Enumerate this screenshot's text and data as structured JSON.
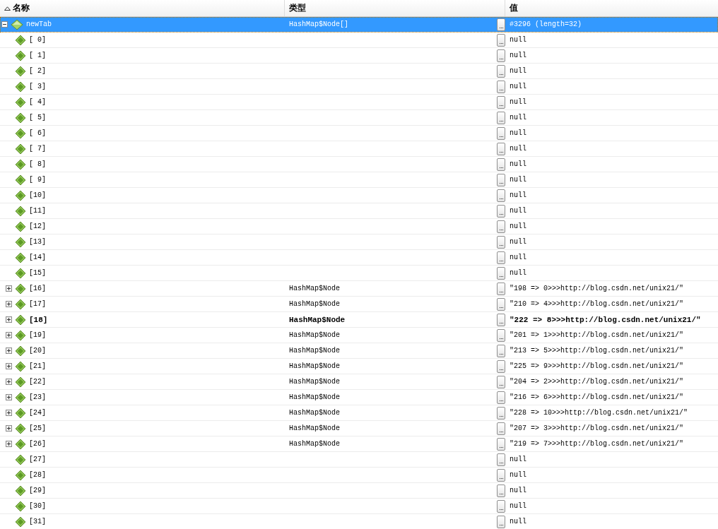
{
  "columns": [
    "名称",
    "类型",
    "值"
  ],
  "root": {
    "name": "newTab",
    "type": "HashMap$Node[]",
    "value": "#3296 (length=32)",
    "selected": true,
    "expanded": true,
    "children": [
      {
        "name": "[ 0]",
        "value": "null",
        "changed": false
      },
      {
        "name": "[ 1]",
        "value": "null",
        "changed": false
      },
      {
        "name": "[ 2]",
        "value": "null",
        "changed": false
      },
      {
        "name": "[ 3]",
        "value": "null",
        "changed": false
      },
      {
        "name": "[ 4]",
        "value": "null",
        "changed": false
      },
      {
        "name": "[ 5]",
        "value": "null",
        "changed": false
      },
      {
        "name": "[ 6]",
        "value": "null",
        "changed": false
      },
      {
        "name": "[ 7]",
        "value": "null",
        "changed": false
      },
      {
        "name": "[ 8]",
        "value": "null",
        "changed": false
      },
      {
        "name": "[ 9]",
        "value": "null",
        "changed": false
      },
      {
        "name": "[10]",
        "value": "null",
        "changed": false
      },
      {
        "name": "[11]",
        "value": "null",
        "changed": false
      },
      {
        "name": "[12]",
        "value": "null",
        "changed": false
      },
      {
        "name": "[13]",
        "value": "null",
        "changed": false
      },
      {
        "name": "[14]",
        "value": "null",
        "changed": false
      },
      {
        "name": "[15]",
        "value": "null",
        "changed": false
      },
      {
        "name": "[16]",
        "type": "HashMap$Node",
        "value": "\"198 => 0>>>http://blog.csdn.net/unix21/\"",
        "expanded": false,
        "changed": false
      },
      {
        "name": "[17]",
        "type": "HashMap$Node",
        "value": "\"210 => 4>>>http://blog.csdn.net/unix21/\"",
        "expanded": false,
        "changed": false
      },
      {
        "name": "[18]",
        "type": "HashMap$Node",
        "value": "\"222 => 8>>>http://blog.csdn.net/unix21/\"",
        "expanded": false,
        "changed": true
      },
      {
        "name": "[19]",
        "type": "HashMap$Node",
        "value": "\"201 => 1>>>http://blog.csdn.net/unix21/\"",
        "expanded": false,
        "changed": false
      },
      {
        "name": "[20]",
        "type": "HashMap$Node",
        "value": "\"213 => 5>>>http://blog.csdn.net/unix21/\"",
        "expanded": false,
        "changed": false
      },
      {
        "name": "[21]",
        "type": "HashMap$Node",
        "value": "\"225 => 9>>>http://blog.csdn.net/unix21/\"",
        "expanded": false,
        "changed": false
      },
      {
        "name": "[22]",
        "type": "HashMap$Node",
        "value": "\"204 => 2>>>http://blog.csdn.net/unix21/\"",
        "expanded": false,
        "changed": false
      },
      {
        "name": "[23]",
        "type": "HashMap$Node",
        "value": "\"216 => 6>>>http://blog.csdn.net/unix21/\"",
        "expanded": false,
        "changed": false
      },
      {
        "name": "[24]",
        "type": "HashMap$Node",
        "value": "\"228 => 10>>>http://blog.csdn.net/unix21/\"",
        "expanded": false,
        "changed": false
      },
      {
        "name": "[25]",
        "type": "HashMap$Node",
        "value": "\"207 => 3>>>http://blog.csdn.net/unix21/\"",
        "expanded": false,
        "changed": false
      },
      {
        "name": "[26]",
        "type": "HashMap$Node",
        "value": "\"219 => 7>>>http://blog.csdn.net/unix21/\"",
        "expanded": false,
        "changed": false
      },
      {
        "name": "[27]",
        "value": "null",
        "changed": false
      },
      {
        "name": "[28]",
        "value": "null",
        "changed": false
      },
      {
        "name": "[29]",
        "value": "null",
        "changed": false
      },
      {
        "name": "[30]",
        "value": "null",
        "changed": false
      },
      {
        "name": "[31]",
        "value": "null",
        "changed": false
      }
    ]
  }
}
